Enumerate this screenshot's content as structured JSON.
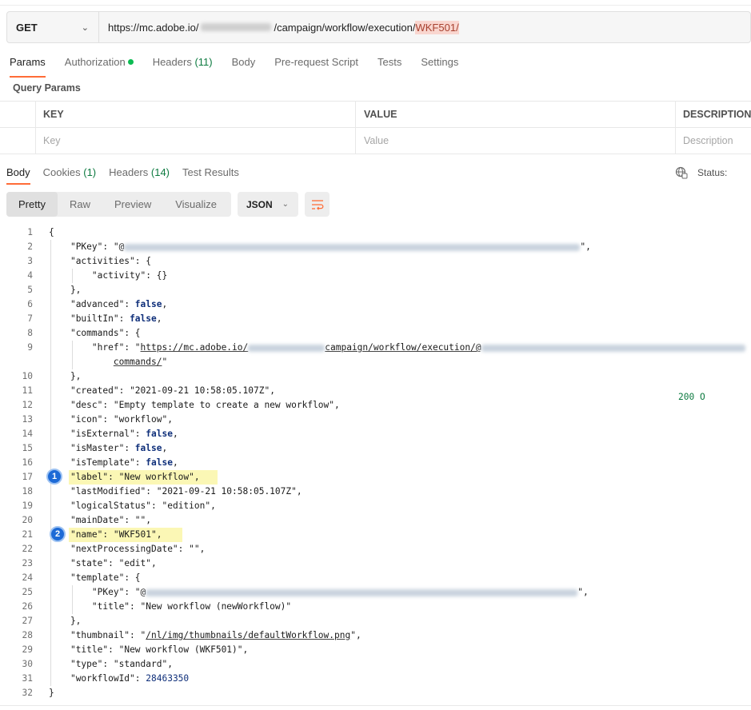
{
  "request": {
    "method": "GET",
    "url_prefix": "https://mc.adobe.io/",
    "url_middle": "/campaign/workflow/execution/",
    "url_highlight": "WKF501",
    "url_suffix": "/"
  },
  "request_tabs": [
    {
      "label": "Params"
    },
    {
      "label": "Authorization"
    },
    {
      "label": "Headers",
      "count": "(11)"
    },
    {
      "label": "Body"
    },
    {
      "label": "Pre-request Script"
    },
    {
      "label": "Tests"
    },
    {
      "label": "Settings"
    }
  ],
  "query_params": {
    "title": "Query Params",
    "headers": {
      "key": "KEY",
      "value": "VALUE",
      "description": "DESCRIPTION"
    },
    "placeholders": {
      "key": "Key",
      "value": "Value",
      "description": "Description"
    }
  },
  "response_tabs": [
    {
      "label": "Body"
    },
    {
      "label": "Cookies",
      "count": "(1)"
    },
    {
      "label": "Headers",
      "count": "(14)"
    },
    {
      "label": "Test Results"
    }
  ],
  "status": {
    "label": "Status:",
    "code": "200 O"
  },
  "view_modes": [
    "Pretty",
    "Raw",
    "Preview",
    "Visualize"
  ],
  "format": "JSON",
  "code_lines": [
    {
      "n": "1",
      "t": "{"
    },
    {
      "n": "2",
      "t": "    \"PKey\": \"@"
    },
    {
      "n": "3",
      "t": "    \"activities\": {"
    },
    {
      "n": "4",
      "t": "        \"activity\": {}"
    },
    {
      "n": "5",
      "t": "    },"
    },
    {
      "n": "6",
      "t": "    \"advanced\": false,"
    },
    {
      "n": "7",
      "t": "    \"builtIn\": false,"
    },
    {
      "n": "8",
      "t": "    \"commands\": {"
    },
    {
      "n": "9",
      "t": "        \"href\": \"https://mc.adobe.io/"
    },
    {
      "n": "",
      "t": "            commands/\""
    },
    {
      "n": "10",
      "t": "    },"
    },
    {
      "n": "11",
      "t": "    \"created\": \"2021-09-21 10:58:05.107Z\","
    },
    {
      "n": "12",
      "t": "    \"desc\": \"Empty template to create a new workflow\","
    },
    {
      "n": "13",
      "t": "    \"icon\": \"workflow\","
    },
    {
      "n": "14",
      "t": "    \"isExternal\": false,"
    },
    {
      "n": "15",
      "t": "    \"isMaster\": false,"
    },
    {
      "n": "16",
      "t": "    \"isTemplate\": false,"
    },
    {
      "n": "17",
      "t": "    \"label\": \"New workflow\","
    },
    {
      "n": "18",
      "t": "    \"lastModified\": \"2021-09-21 10:58:05.107Z\","
    },
    {
      "n": "19",
      "t": "    \"logicalStatus\": \"edition\","
    },
    {
      "n": "20",
      "t": "    \"mainDate\": \"\","
    },
    {
      "n": "21",
      "t": "    \"name\": \"WKF501\","
    },
    {
      "n": "22",
      "t": "    \"nextProcessingDate\": \"\","
    },
    {
      "n": "23",
      "t": "    \"state\": \"edit\","
    },
    {
      "n": "24",
      "t": "    \"template\": {"
    },
    {
      "n": "25",
      "t": "        \"PKey\": \"@"
    },
    {
      "n": "26",
      "t": "        \"title\": \"New workflow (newWorkflow)\""
    },
    {
      "n": "27",
      "t": "    },"
    },
    {
      "n": "28",
      "t": "    \"thumbnail\": \"/nl/img/thumbnails/defaultWorkflow.png\","
    },
    {
      "n": "29",
      "t": "    \"title\": \"New workflow (WKF501)\","
    },
    {
      "n": "30",
      "t": "    \"type\": \"standard\","
    },
    {
      "n": "31",
      "t": "    \"workflowId\": 28463350"
    },
    {
      "n": "32",
      "t": "}"
    }
  ],
  "callouts": [
    "1",
    "2"
  ],
  "colors": {
    "accent": "#ff6c37",
    "ok": "#0d7a40",
    "callout": "#1d6ad6",
    "highlight": "#fbf7b5"
  }
}
